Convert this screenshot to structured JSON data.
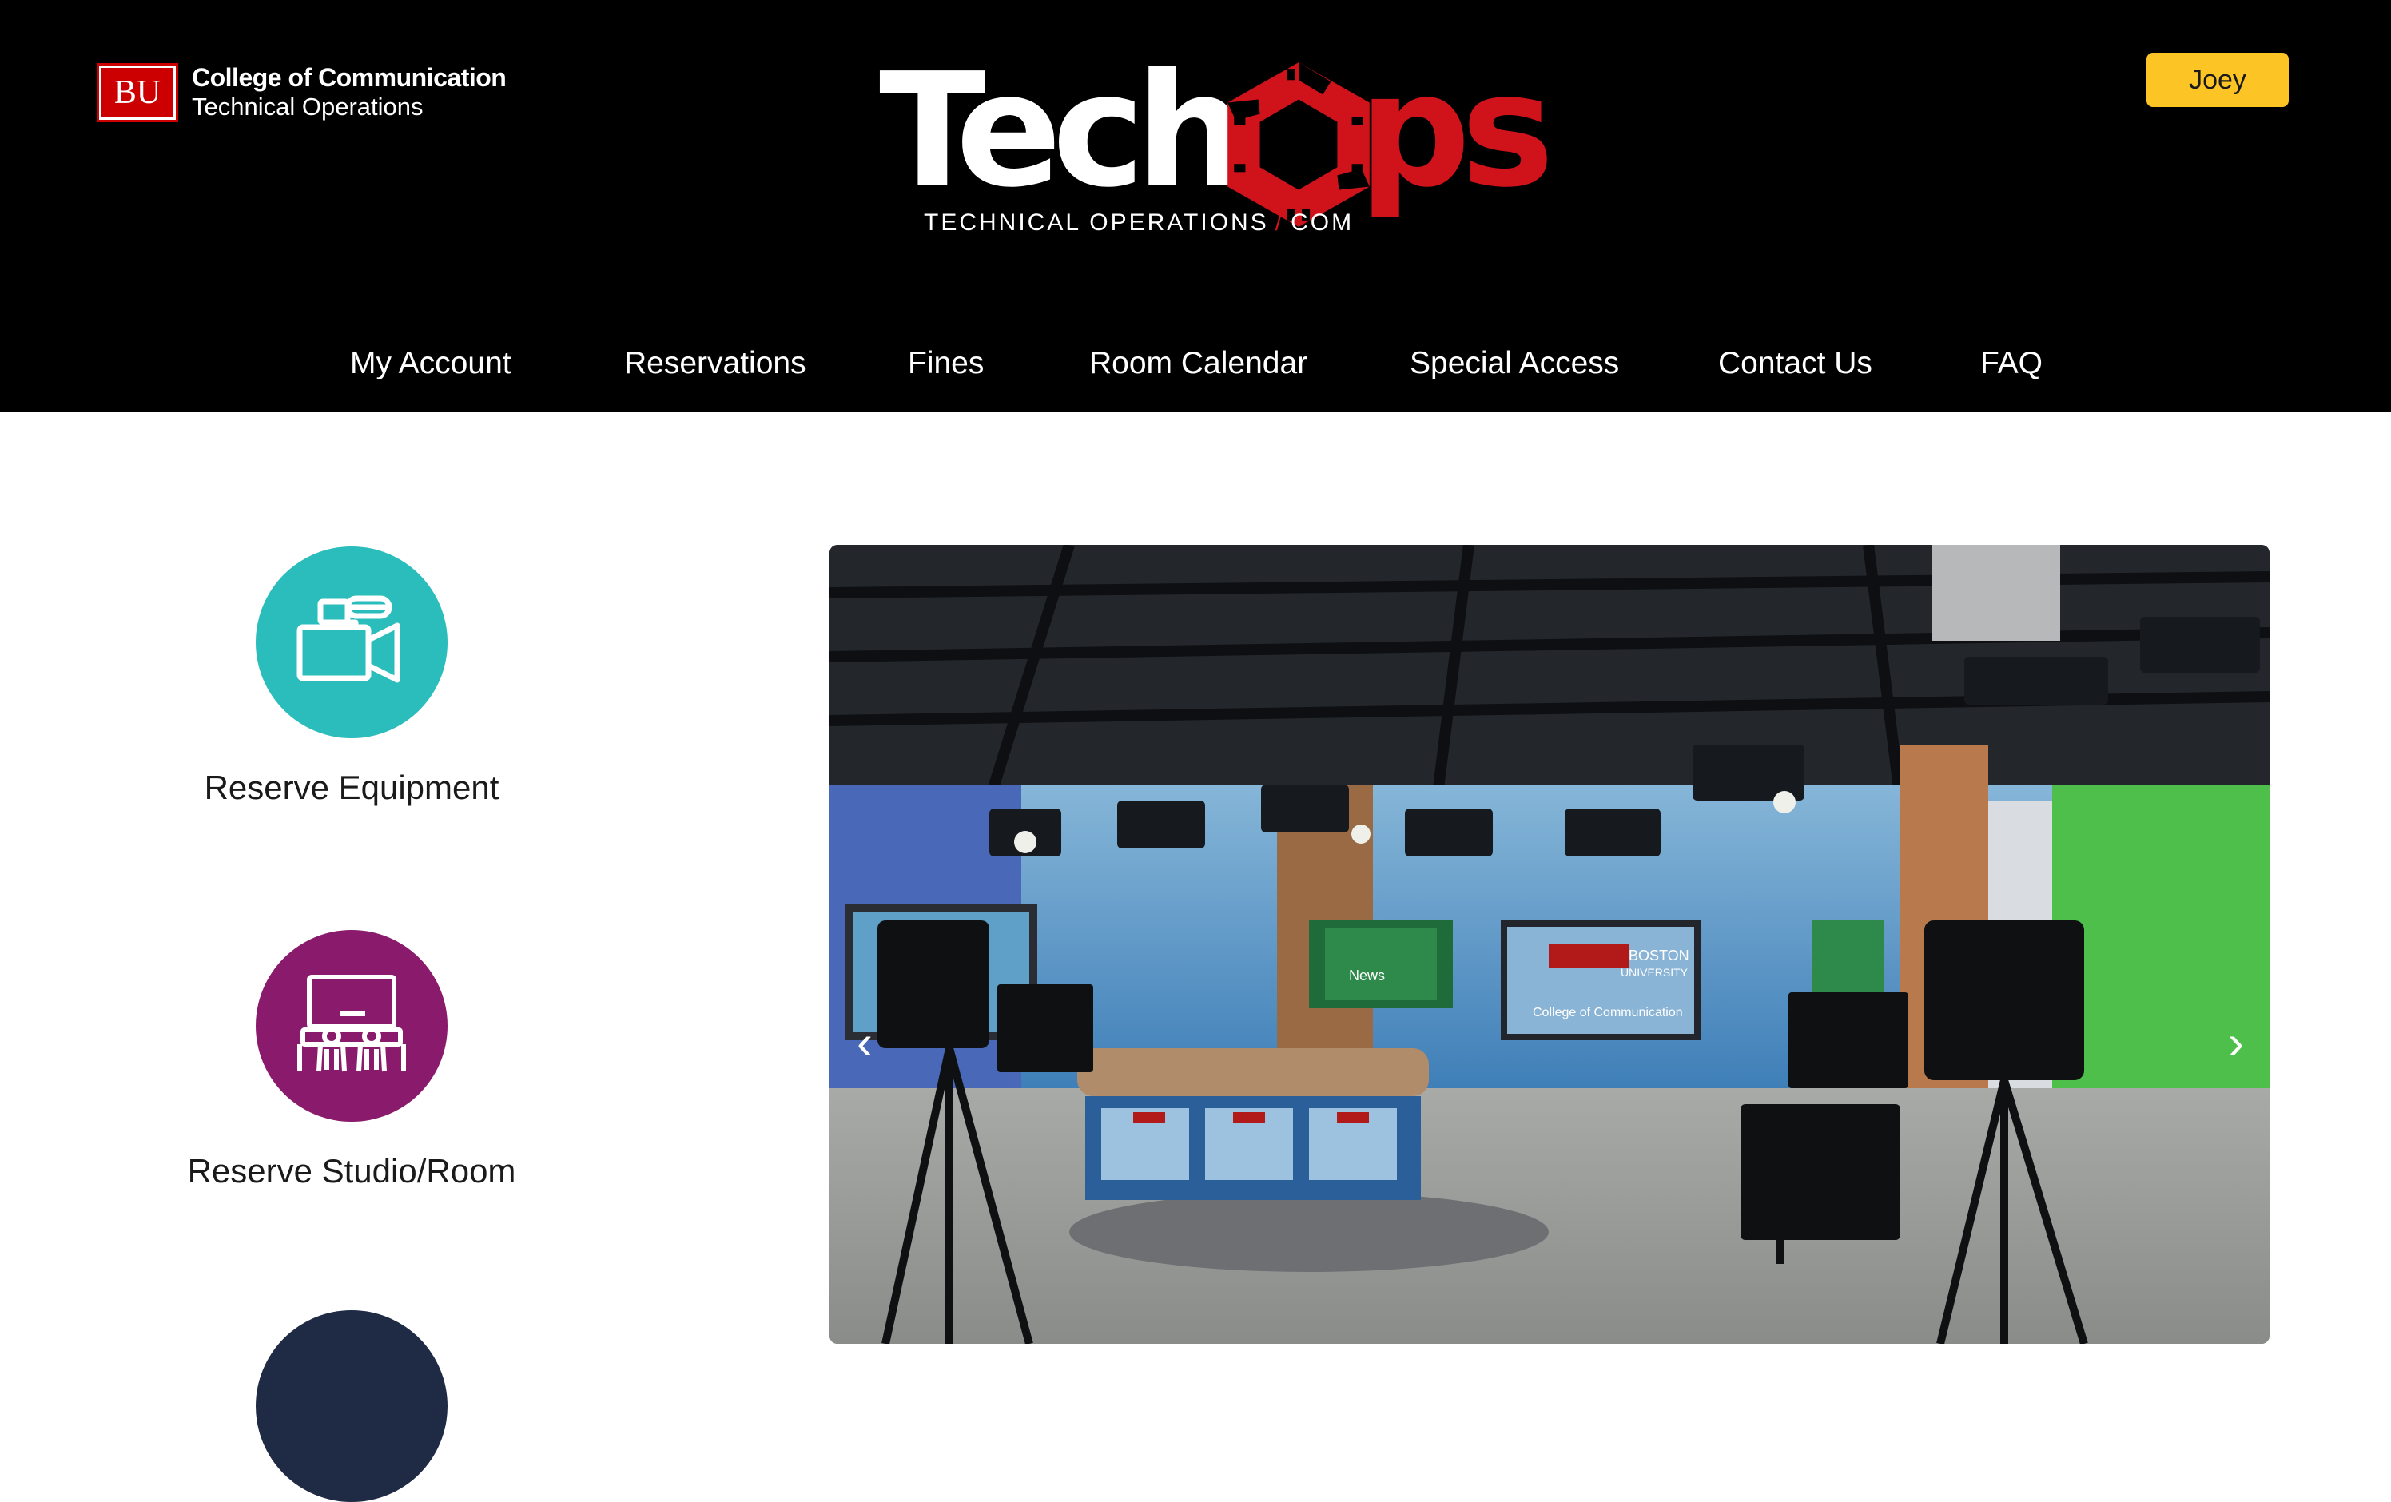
{
  "brand": {
    "bu_mark": "BU",
    "line1": "College of Communication",
    "line2": "Technical Operations"
  },
  "logo": {
    "word": "TechOps",
    "subtitle_left": "TECHNICAL OPERATIONS",
    "subtitle_sep": "/",
    "subtitle_right": "COM"
  },
  "user": {
    "label": "Joey"
  },
  "nav": {
    "items": [
      {
        "label": "My Account"
      },
      {
        "label": "Reservations"
      },
      {
        "label": "Fines"
      },
      {
        "label": "Room Calendar"
      },
      {
        "label": "Special Access"
      },
      {
        "label": "Contact Us"
      },
      {
        "label": "FAQ"
      }
    ]
  },
  "actions": [
    {
      "label": "Reserve Equipment",
      "icon": "video-camera-icon",
      "color": "#2bbcbc"
    },
    {
      "label": "Reserve Studio/Room",
      "icon": "classroom-icon",
      "color": "#8a1a6b"
    }
  ],
  "carousel": {
    "prev": "‹",
    "next": "›",
    "screen_text": {
      "news": "News",
      "boston": "BOSTON",
      "university": "UNIVERSITY",
      "college": "College of Communication"
    }
  },
  "colors": {
    "header_bg": "#000000",
    "brand_red": "#d0121b",
    "accent_yellow": "#fdc426",
    "teal": "#2bbcbc",
    "plum": "#8a1a6b"
  }
}
